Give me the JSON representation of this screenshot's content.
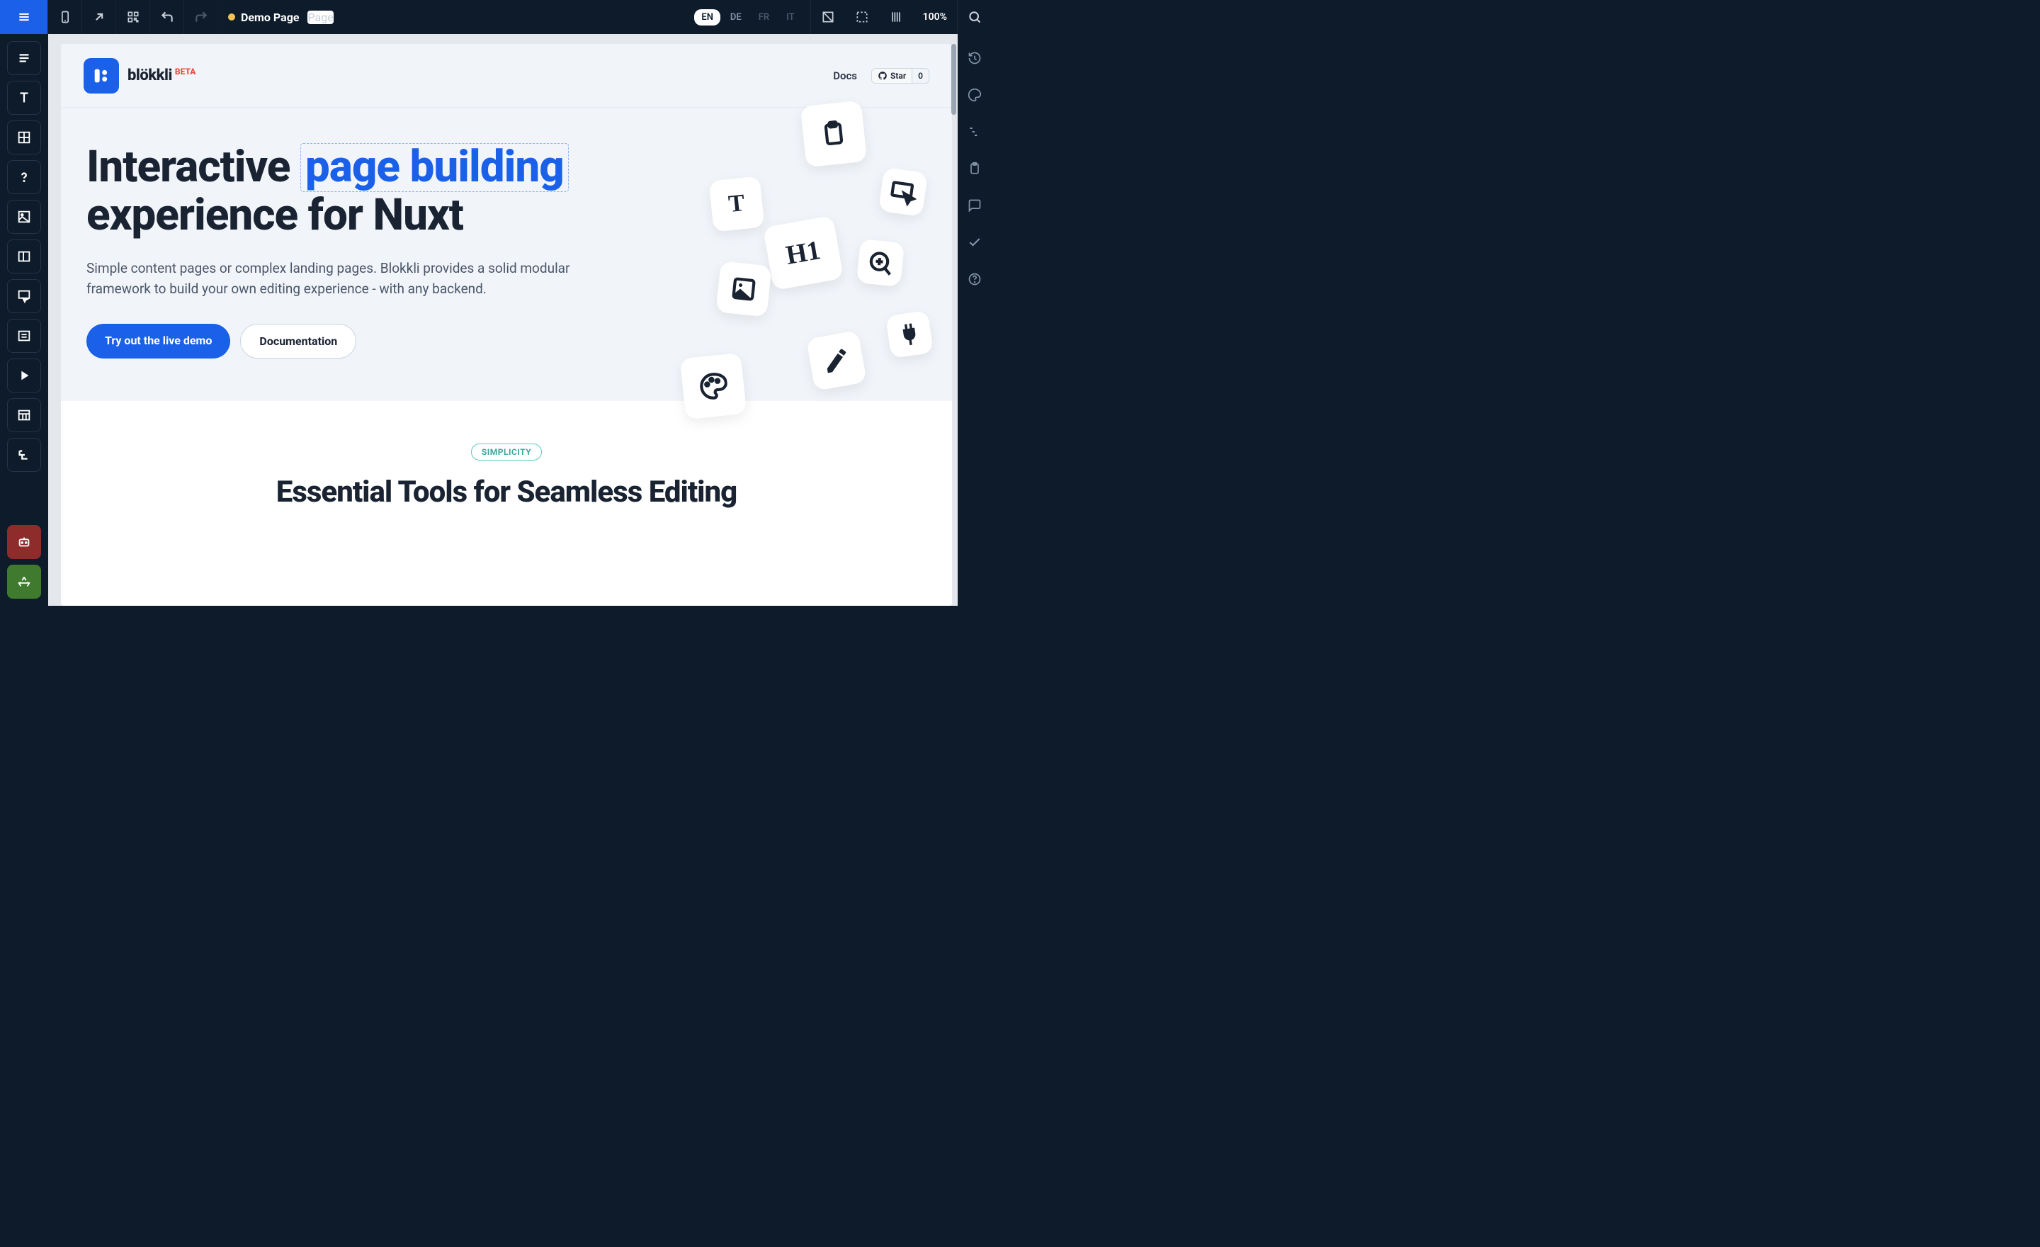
{
  "topbar": {
    "title_bold": "Demo Page",
    "title_page": "Page",
    "languages": [
      "EN",
      "DE",
      "FR",
      "IT"
    ],
    "active_language": "EN",
    "zoom": "100%"
  },
  "page_header": {
    "brand": "blökkli",
    "beta_badge": "BETA",
    "docs_label": "Docs",
    "github_star_label": "Star",
    "github_star_count": "0"
  },
  "hero": {
    "title_part1": "Interactive ",
    "title_highlight": "page building",
    "title_part2": " experience for Nuxt",
    "description": "Simple content pages or complex landing pages. Blokkli provides a solid modular framework to build your own editing experience - with any backend.",
    "cta_primary": "Try out the live demo",
    "cta_secondary": "Documentation",
    "card_t": "T",
    "card_h1": "H1"
  },
  "section": {
    "tag": "SIMPLICITY",
    "heading": "Essential Tools for Seamless Editing"
  }
}
